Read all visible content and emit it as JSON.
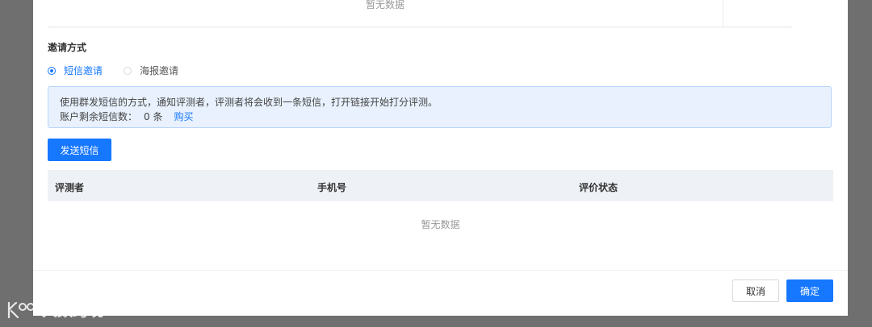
{
  "top_table": {
    "empty_text": "暂无数据"
  },
  "invite": {
    "section_title": "邀请方式",
    "options": [
      {
        "label": "短信邀请",
        "checked": true
      },
      {
        "label": "海报邀请",
        "checked": false
      }
    ]
  },
  "alert": {
    "line1": "使用群发短信的方式，通知评测者，评测者将会收到一条短信，打开链接开始打分评测。",
    "remaining_label": "账户剩余短信数：",
    "remaining_count": "0 条",
    "buy_link": "购买"
  },
  "send_button": "发送短信",
  "table": {
    "columns": [
      "评测者",
      "手机号",
      "评价状态"
    ],
    "empty_text": "暂无数据"
  },
  "footer": {
    "cancel": "取消",
    "confirm": "确定"
  },
  "watermark": {
    "text": "大数跨境"
  },
  "colors": {
    "primary": "#1677ff",
    "alert_bg": "#e8f1fd",
    "table_head_bg": "#eef1f6",
    "overlay": "#6f6f6f"
  }
}
